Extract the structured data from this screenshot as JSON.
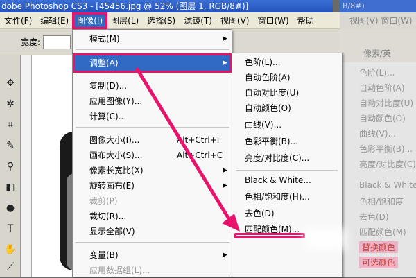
{
  "titlebar": {
    "text": "dobe Photoshop CS3 - [45456.jpg @ 52% (图层 1, RGB/8#)]"
  },
  "menubar": {
    "items": [
      "文件(F)",
      "编辑(E)",
      "图像(I)",
      "图层(L)",
      "选择(S)",
      "滤镜(T)",
      "视图(V)",
      "窗口(W)",
      "帮助"
    ]
  },
  "options": {
    "width_label": "宽度:",
    "unit": "像素/英寸"
  },
  "image_menu": {
    "items": [
      {
        "label": "模式(M)",
        "arrow": true
      },
      {
        "label": "调整(A)",
        "arrow": true,
        "highlighted": true
      },
      {
        "label": "复制(D)..."
      },
      {
        "label": "应用图像(Y)..."
      },
      {
        "label": "计算(C)..."
      },
      {
        "label": "图像大小(I)...",
        "shortcut": "Alt+Ctrl+I"
      },
      {
        "label": "画布大小(S)...",
        "shortcut": "Alt+Ctrl+C"
      },
      {
        "label": "像素长宽比(X)",
        "arrow": true
      },
      {
        "label": "旋转画布(E)",
        "arrow": true
      },
      {
        "label": "裁剪(P)",
        "disabled": true
      },
      {
        "label": "裁切(R)..."
      },
      {
        "label": "显示全部(V)"
      },
      {
        "label": "变量(B)",
        "arrow": true
      },
      {
        "label": "应用数据组(L)...",
        "disabled": true
      }
    ]
  },
  "adjust_submenu": {
    "items": [
      "色阶(L)...",
      "自动色阶(A)",
      "自动对比度(U)",
      "自动颜色(O)",
      "曲线(V)...",
      "色彩平衡(B)...",
      "亮度/对比度(C)...",
      "Black & White...",
      "色相/饱和度(H)...",
      "去色(D)",
      "匹配颜色(M)..."
    ]
  },
  "right_panel": {
    "title": "B/8#)",
    "menu": "视图(V)  窗口(W)",
    "unit": "像素/英",
    "items": [
      "色阶(L)...",
      "自动色阶(A)",
      "自动对比度(U)",
      "自动颜色(O)",
      "曲线(V)...",
      "色彩平衡(B)...",
      "亮度/对比度(C)...",
      "Black & White",
      "色相/饱和度",
      "去色(D)",
      "匹配颜色(M)",
      "替换颜色",
      "可选颜色"
    ]
  },
  "colors": {
    "highlight": "#316ac5",
    "annotation": "#e8146b"
  }
}
